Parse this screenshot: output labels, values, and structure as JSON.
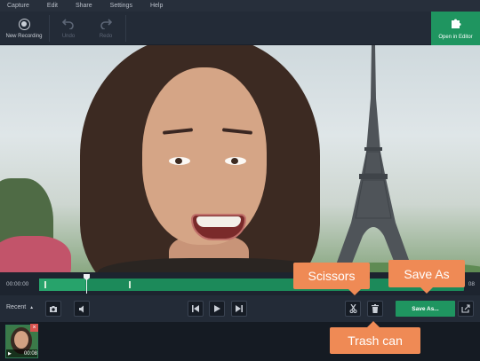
{
  "menu": [
    "Capture",
    "Edit",
    "Share",
    "Settings",
    "Help"
  ],
  "toolbar": {
    "new_recording": "New Recording",
    "undo": "Undo",
    "redo": "Redo",
    "open_in_editor": "Open in Editor"
  },
  "timeline": {
    "current_time": "00:00:00",
    "end_time": "08"
  },
  "controls": {
    "recent_label": "Recent",
    "save_as": "Save As..."
  },
  "recent_items": [
    {
      "duration": "00:08"
    }
  ],
  "callouts": {
    "scissors": "Scissors",
    "save_as": "Save As",
    "trash_can": "Trash can"
  },
  "colors": {
    "accent_green": "#1f9560",
    "callout_orange": "#ef8a55",
    "background": "#1f2733"
  }
}
